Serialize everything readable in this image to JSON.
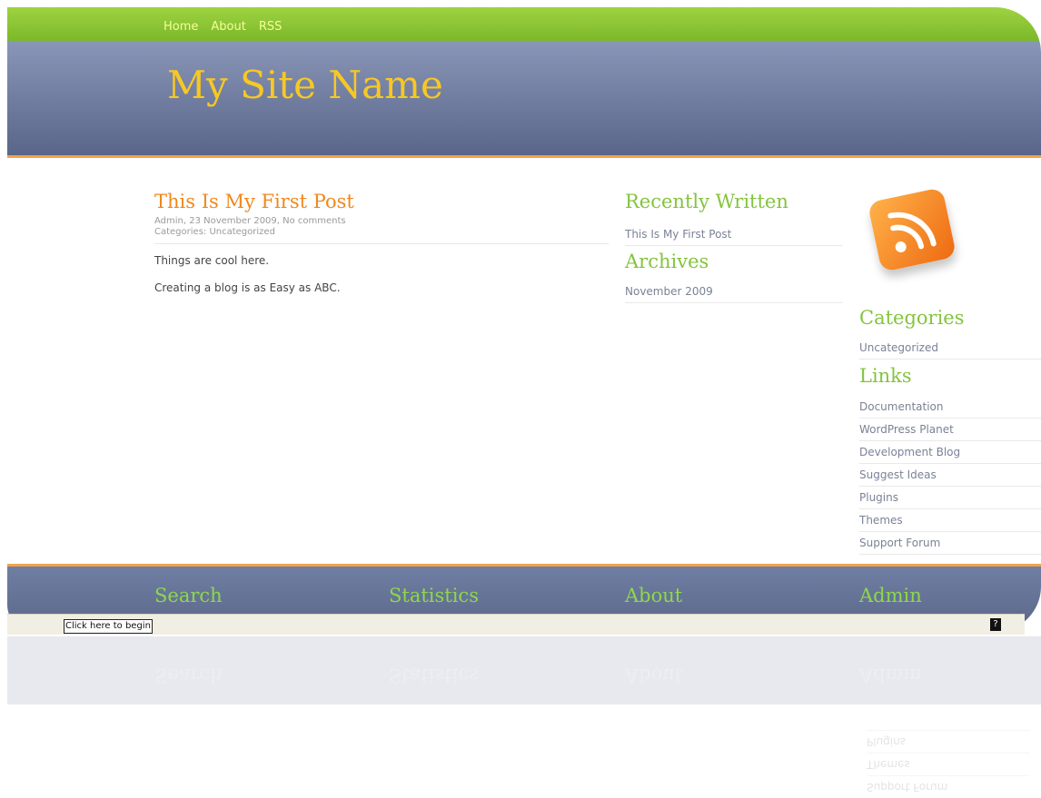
{
  "nav": [
    "Home",
    "About",
    "RSS"
  ],
  "site": {
    "name": "My Site Name"
  },
  "post": {
    "title": "This Is My First Post",
    "meta_line1": "Admin, 23 November 2009, No comments",
    "meta_line2": "Categories: Uncategorized",
    "body": [
      "Things are cool here.",
      "Creating a blog is as Easy as ABC."
    ]
  },
  "recently_written": {
    "heading": "Recently Written",
    "items": [
      "This Is My First Post"
    ]
  },
  "archives": {
    "heading": "Archives",
    "items": [
      "November 2009"
    ]
  },
  "categories": {
    "heading": "Categories",
    "items": [
      "Uncategorized"
    ]
  },
  "links": {
    "heading": "Links",
    "items": [
      "Documentation",
      "WordPress Planet",
      "Development Blog",
      "Suggest Ideas",
      "Plugins",
      "Themes",
      "Support Forum"
    ]
  },
  "footer": [
    "Search",
    "Statistics",
    "About",
    "Admin"
  ],
  "statusbar": {
    "button": "Click here to begin"
  },
  "icons": {
    "rss": "rss-icon",
    "status": "status-icon"
  },
  "colors": {
    "accent_green": "#84c43d",
    "title_orange": "#f0881d",
    "site_name_yellow": "#f7c823",
    "header_blue": "#7282a8"
  }
}
